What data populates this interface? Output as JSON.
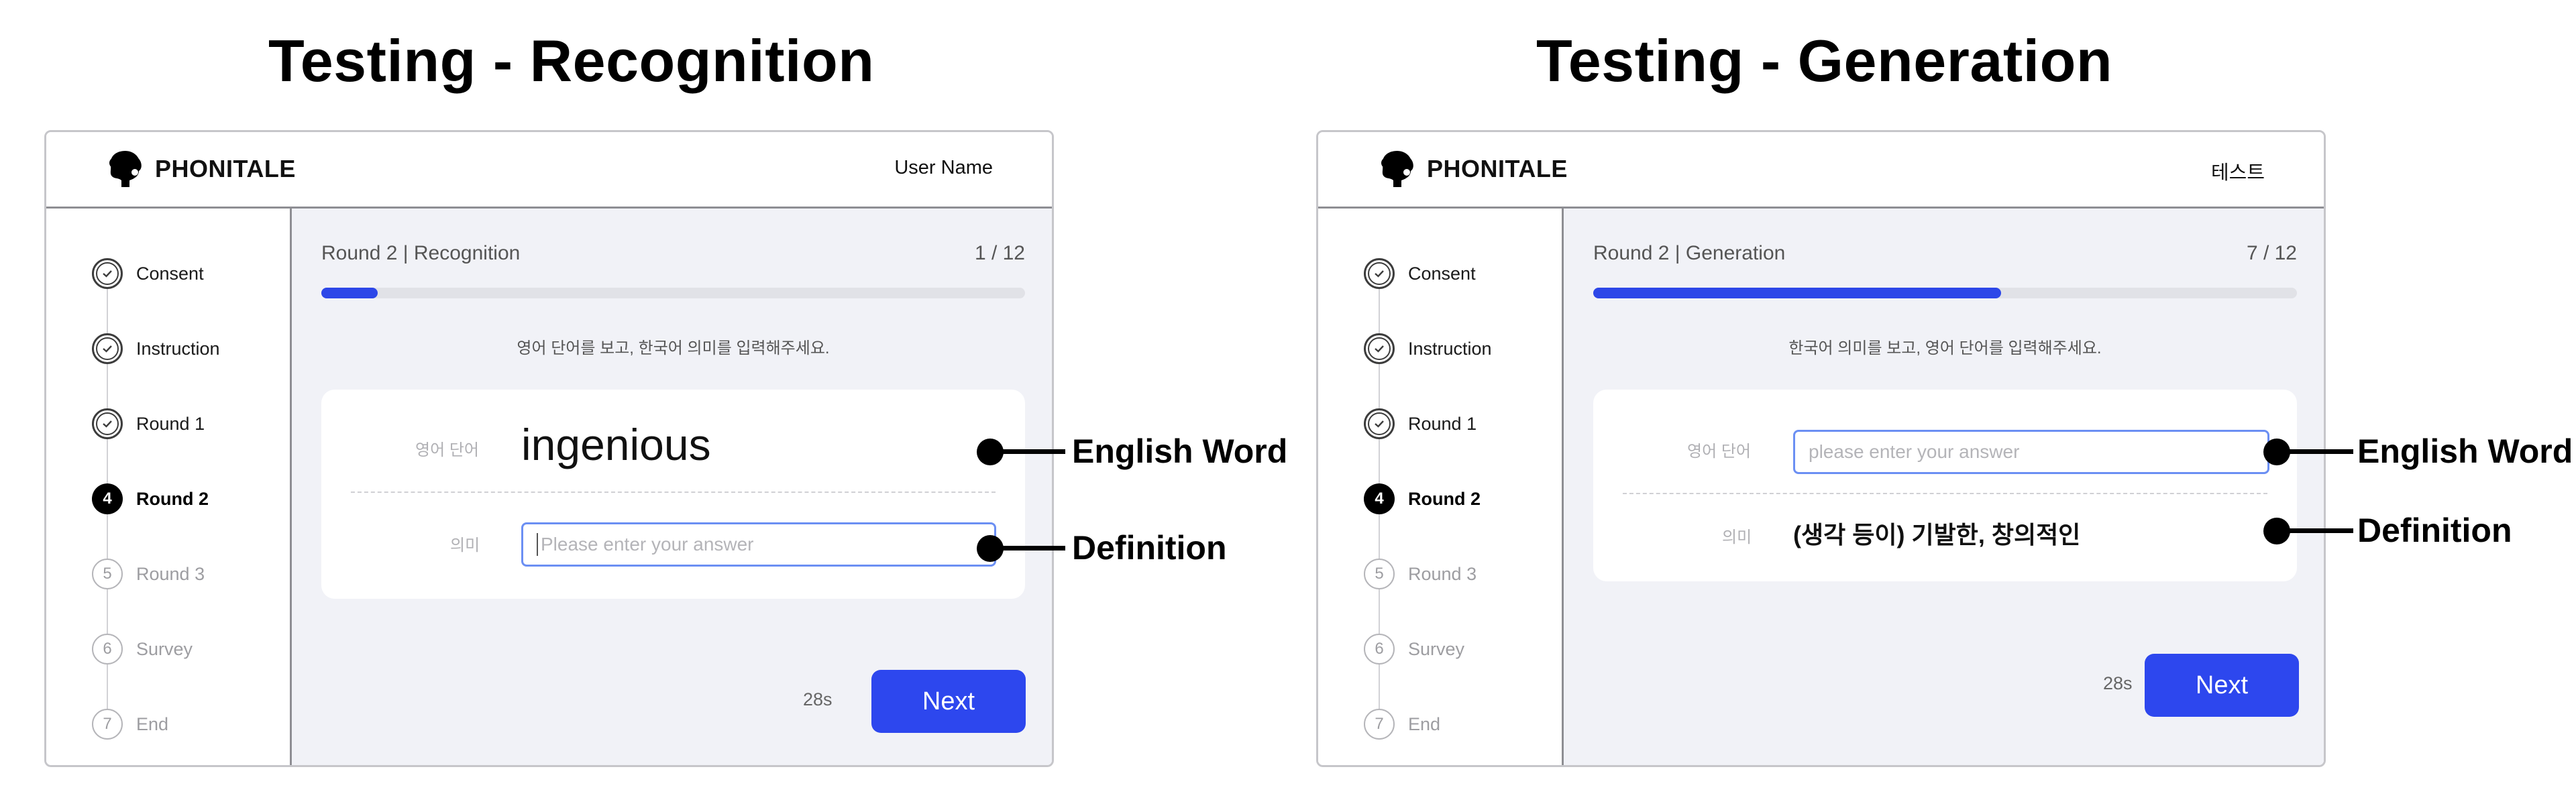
{
  "left_panel": {
    "title": "Testing - Recognition",
    "brand": "PHONITALE",
    "user": "User Name",
    "steps": [
      {
        "label": "Consent",
        "state": "done"
      },
      {
        "label": "Instruction",
        "state": "done"
      },
      {
        "label": "Round 1",
        "state": "done"
      },
      {
        "label": "Round 2",
        "state": "active",
        "num": "4"
      },
      {
        "label": "Round 3",
        "state": "todo",
        "num": "5"
      },
      {
        "label": "Survey",
        "state": "todo",
        "num": "6"
      },
      {
        "label": "End",
        "state": "todo",
        "num": "7"
      }
    ],
    "round": "Round 2 | Recognition",
    "counter": "1 / 12",
    "progress": 0.08,
    "instruction": "영어 단어를 보고, 한국어 의미를 입력해주세요.",
    "word_label": "영어 단어",
    "word": "ingenious",
    "meaning_label": "의미",
    "input_placeholder": "Please enter your answer",
    "timer": "28s",
    "next_label": "Next",
    "annotations": {
      "word": "English Word",
      "definition": "Definition"
    }
  },
  "right_panel": {
    "title": "Testing - Generation",
    "brand": "PHONITALE",
    "user": "테스트",
    "steps": [
      {
        "label": "Consent",
        "state": "done"
      },
      {
        "label": "Instruction",
        "state": "done"
      },
      {
        "label": "Round 1",
        "state": "done"
      },
      {
        "label": "Round 2",
        "state": "active",
        "num": "4"
      },
      {
        "label": "Round 3",
        "state": "todo",
        "num": "5"
      },
      {
        "label": "Survey",
        "state": "todo",
        "num": "6"
      },
      {
        "label": "End",
        "state": "todo",
        "num": "7"
      }
    ],
    "round": "Round 2 | Generation",
    "counter": "7 / 12",
    "progress": 0.58,
    "instruction": "한국어 의미를 보고, 영어 단어를 입력해주세요.",
    "word_label": "영어 단어",
    "input_placeholder": "please enter your answer",
    "meaning_label": "의미",
    "definition": "(생각 등이) 기발한, 창의적인",
    "timer": "28s",
    "next_label": "Next",
    "annotations": {
      "word": "English Word",
      "definition": "Definition"
    }
  }
}
